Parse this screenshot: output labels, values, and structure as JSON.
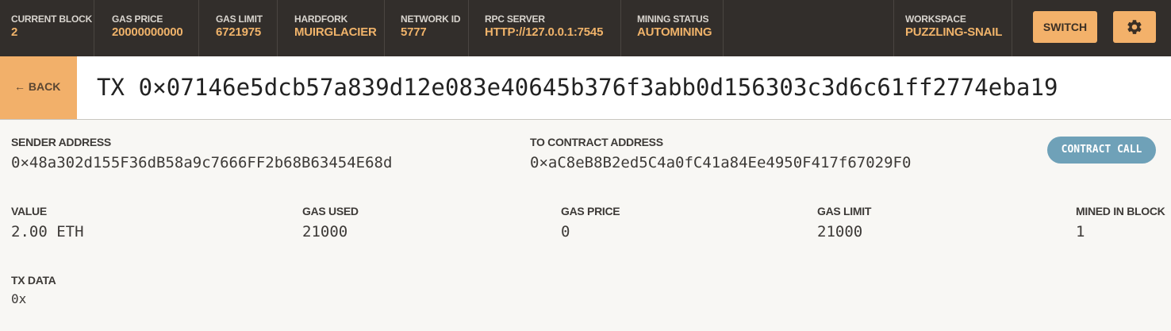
{
  "topbar": {
    "stats": [
      {
        "label": "CURRENT BLOCK",
        "value": "2"
      },
      {
        "label": "GAS PRICE",
        "value": "20000000000"
      },
      {
        "label": "GAS LIMIT",
        "value": "6721975"
      },
      {
        "label": "HARDFORK",
        "value": "MUIRGLACIER"
      },
      {
        "label": "NETWORK ID",
        "value": "5777"
      },
      {
        "label": "RPC SERVER",
        "value": "HTTP://127.0.0.1:7545"
      },
      {
        "label": "MINING STATUS",
        "value": "AUTOMINING"
      }
    ],
    "workspace": {
      "label": "WORKSPACE",
      "value": "PUZZLING-SNAIL"
    },
    "switch_label": "SWITCH",
    "settings_icon": "gear-icon"
  },
  "txbar": {
    "back_label": "← BACK",
    "title": "TX 0×07146e5dcb57a839d12e083e40645b376f3abb0d156303c3d6c61ff2774eba19"
  },
  "details": {
    "sender": {
      "label": "SENDER ADDRESS",
      "value": "0×48a302d155F36dB58a9c7666FF2b68B63454E68d"
    },
    "to_contract": {
      "label": "TO CONTRACT ADDRESS",
      "value": "0×aC8eB8B2ed5C4a0fC41a84Ee4950F417f67029F0"
    },
    "badge": "CONTRACT CALL",
    "value": {
      "label": "VALUE",
      "value": "2.00 ETH"
    },
    "gas_used": {
      "label": "GAS USED",
      "value": "21000"
    },
    "gas_price": {
      "label": "GAS PRICE",
      "value": "0"
    },
    "gas_limit": {
      "label": "GAS LIMIT",
      "value": "21000"
    },
    "mined_in_block": {
      "label": "MINED IN BLOCK",
      "value": "1"
    },
    "tx_data": {
      "label": "TX DATA",
      "value": "0x"
    }
  },
  "colors": {
    "topbar_bg": "#322e2b",
    "accent": "#f3b16a",
    "stat_value": "#f0b36a",
    "badge": "#6fa1b8",
    "page_bg": "#f8f7f4"
  }
}
